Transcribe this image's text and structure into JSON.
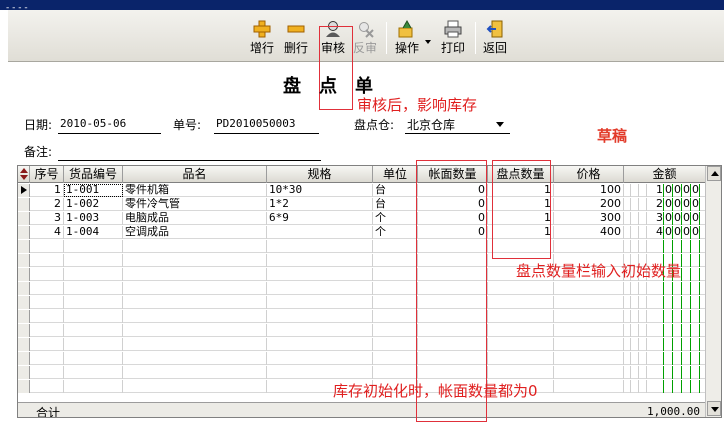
{
  "window": {
    "title": "- - - -"
  },
  "toolbar": {
    "add_row": "增行",
    "delete_row": "删行",
    "audit": "审核",
    "unaudit": "反审",
    "operate": "操作",
    "print": "打印",
    "back": "返回"
  },
  "form": {
    "title_chars": [
      "盘",
      "点",
      "单"
    ],
    "draft_stamp": "草稿",
    "date_label": "日期:",
    "date_value": "2010-05-06",
    "number_label": "单号:",
    "number_value": "PD2010050003",
    "warehouse_label": "盘点仓:",
    "warehouse_value": "北京仓库",
    "remark_label": "备注:"
  },
  "annotations": {
    "audit_note": "审核后，影响库存",
    "count_note": "盘点数量栏输入初始数量",
    "book_note": "库存初始化时，帐面数量都为0"
  },
  "grid": {
    "columns": [
      "序号",
      "货品编号",
      "品名",
      "规格",
      "单位",
      "帐面数量",
      "盘点数量",
      "价格",
      "金额"
    ],
    "rows": [
      {
        "seq": "1",
        "code": "1-001",
        "name": "零件机箱",
        "spec": "10*30",
        "unit": "台",
        "book_qty": "0",
        "count_qty": "1",
        "price": "100",
        "amount_digits": [
          "1",
          "0",
          "0",
          "0",
          "0"
        ]
      },
      {
        "seq": "2",
        "code": "1-002",
        "name": "零件冷气管",
        "spec": "1*2",
        "unit": "台",
        "book_qty": "0",
        "count_qty": "1",
        "price": "200",
        "amount_digits": [
          "2",
          "0",
          "0",
          "0",
          "0"
        ]
      },
      {
        "seq": "3",
        "code": "1-003",
        "name": "电脑成品",
        "spec": "6*9",
        "unit": "个",
        "book_qty": "0",
        "count_qty": "1",
        "price": "300",
        "amount_digits": [
          "3",
          "0",
          "0",
          "0",
          "0"
        ]
      },
      {
        "seq": "4",
        "code": "1-004",
        "name": "空调成品",
        "spec": "",
        "unit": "个",
        "book_qty": "0",
        "count_qty": "1",
        "price": "400",
        "amount_digits": [
          "4",
          "0",
          "0",
          "0",
          "0"
        ]
      }
    ],
    "footer_label": "合计",
    "footer_total": "1,000.00"
  },
  "colors": {
    "annotation": "#e02020",
    "draft": "#e23b2a",
    "amount_grid": "#00a000"
  }
}
